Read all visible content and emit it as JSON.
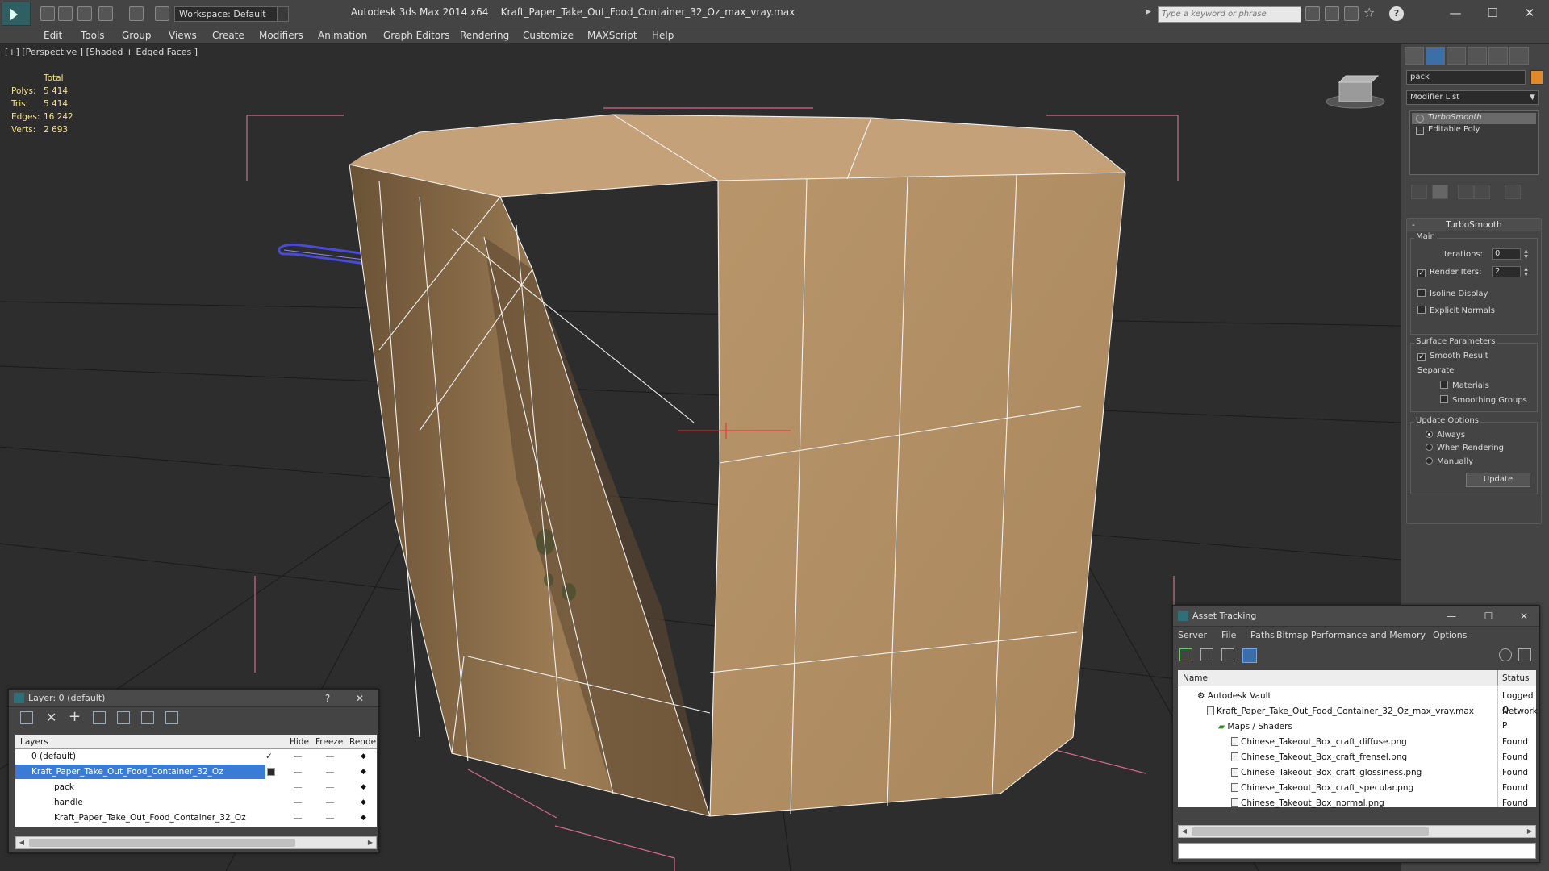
{
  "app": {
    "product": "Autodesk 3ds Max  2014 x64",
    "file": "Kraft_Paper_Take_Out_Food_Container_32_Oz_max_vray.max",
    "workspace": "Workspace: Default",
    "search_placeholder": "Type a keyword or phrase"
  },
  "menu": [
    "Edit",
    "Tools",
    "Group",
    "Views",
    "Create",
    "Modifiers",
    "Animation",
    "Graph Editors",
    "Rendering",
    "Customize",
    "MAXScript",
    "Help"
  ],
  "viewport": {
    "label": "[+] [Perspective ] [Shaded + Edged Faces ]",
    "stats": {
      "header": "Total",
      "rows": [
        {
          "label": "Polys:",
          "value": "5 414"
        },
        {
          "label": "Tris:",
          "value": "5 414"
        },
        {
          "label": "Edges:",
          "value": "16 242"
        },
        {
          "label": "Verts:",
          "value": "2 693"
        }
      ]
    }
  },
  "command_panel": {
    "object_name": "pack",
    "object_color": "#e08a2a",
    "modifier_list": "Modifier List",
    "stack": [
      "TurboSmooth",
      "Editable Poly"
    ],
    "rollout_title": "TurboSmooth",
    "main": {
      "title": "Main",
      "iterations_label": "Iterations:",
      "iterations": "0",
      "render_iters_label": "Render Iters:",
      "render_iters": "2",
      "isoline": "Isoline Display",
      "explicit_normals": "Explicit Normals"
    },
    "surface": {
      "title": "Surface Parameters",
      "smooth_result": "Smooth Result",
      "separate": "Separate",
      "materials": "Materials",
      "smoothing_groups": "Smoothing Groups"
    },
    "update": {
      "title": "Update Options",
      "always": "Always",
      "when_rendering": "When Rendering",
      "manually": "Manually",
      "button": "Update"
    }
  },
  "layer_window": {
    "title": "Layer: 0 (default)",
    "columns": [
      "Layers",
      "Hide",
      "Freeze",
      "Rende"
    ],
    "rows": [
      {
        "name": "0 (default)"
      },
      {
        "name": "Kraft_Paper_Take_Out_Food_Container_32_Oz"
      },
      {
        "name": "pack"
      },
      {
        "name": "handle"
      },
      {
        "name": "Kraft_Paper_Take_Out_Food_Container_32_Oz"
      }
    ]
  },
  "asset_window": {
    "title": "Asset Tracking",
    "menu": [
      "Server",
      "File",
      "Paths",
      "Bitmap Performance and Memory",
      "Options"
    ],
    "columns": [
      "Name",
      "Status"
    ],
    "rows": [
      {
        "name": "Autodesk Vault",
        "status": "Logged O"
      },
      {
        "name": "Kraft_Paper_Take_Out_Food_Container_32_Oz_max_vray.max",
        "status": "Network P"
      },
      {
        "name": "Maps / Shaders",
        "status": ""
      },
      {
        "name": "Chinese_Takeout_Box_craft_diffuse.png",
        "status": "Found"
      },
      {
        "name": "Chinese_Takeout_Box_craft_frensel.png",
        "status": "Found"
      },
      {
        "name": "Chinese_Takeout_Box_craft_glossiness.png",
        "status": "Found"
      },
      {
        "name": "Chinese_Takeout_Box_craft_specular.png",
        "status": "Found"
      },
      {
        "name": "Chinese_Takeout_Box_normal.png",
        "status": "Found"
      }
    ]
  },
  "colors": {
    "selection": "#3a7bd5",
    "stats_text": "#f2e08a",
    "kraft": "#b89468",
    "handle": "#4a4ad8"
  }
}
